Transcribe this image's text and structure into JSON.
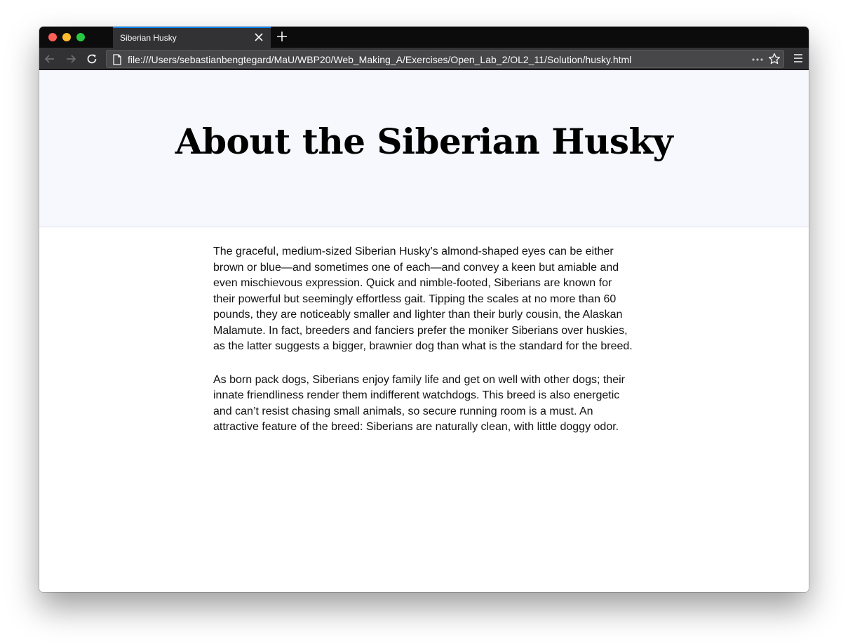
{
  "browser": {
    "tab_title": "Siberian Husky",
    "url": "file:///Users/sebastianbengtegard/MaU/WBP20/Web_Making_A/Exercises/Open_Lab_2/OL2_11/Solution/husky.html"
  },
  "page": {
    "heading": "About the Siberian Husky",
    "paragraphs": [
      "The graceful, medium-sized Siberian Husky’s almond-shaped eyes can be either brown or blue—and sometimes one of each—and convey a keen but amiable and even mischievous expression. Quick and nimble-footed, Siberians are known for their powerful but seemingly effortless gait. Tipping the scales at no more than 60 pounds, they are noticeably smaller and lighter than their burly cousin, the Alaskan Malamute. In fact, breeders and fanciers prefer the moniker Siberians over huskies, as the latter suggests a bigger, brawnier dog than what is the standard for the breed.",
      "As born pack dogs, Siberians enjoy family life and get on well with other dogs; their innate friendliness render them indifferent watchdogs. This breed is also energetic and can’t resist chasing small animals, so secure running room is a must. An attractive feature of the breed: Siberians are naturally clean, with little doggy odor."
    ]
  },
  "colors": {
    "hero_background": "#f7f8fd",
    "tab_accent": "#0a84ff",
    "toolbar": "#323234"
  }
}
